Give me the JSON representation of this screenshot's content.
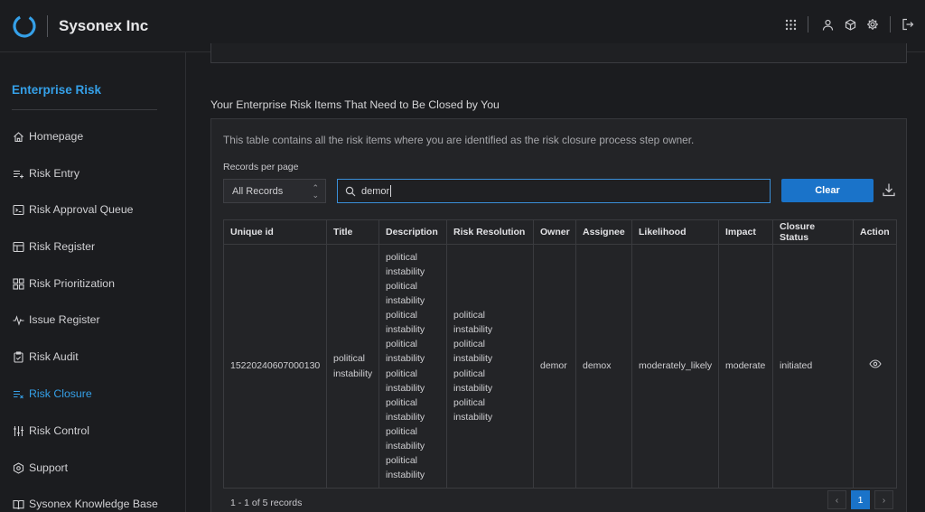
{
  "header": {
    "brand": "Sysonex Inc",
    "icons": [
      "apps-grid-icon",
      "user-icon",
      "cube-icon",
      "gear-icon",
      "logout-icon"
    ]
  },
  "sidebar": {
    "title": "Enterprise Risk",
    "items": [
      {
        "label": "Homepage",
        "icon": "home-icon"
      },
      {
        "label": "Risk Entry",
        "icon": "list-add-icon"
      },
      {
        "label": "Risk Approval Queue",
        "icon": "terminal-icon"
      },
      {
        "label": "Risk Register",
        "icon": "table-icon"
      },
      {
        "label": "Risk Prioritization",
        "icon": "grid-icon"
      },
      {
        "label": "Issue Register",
        "icon": "pulse-icon"
      },
      {
        "label": "Risk Audit",
        "icon": "clipboard-icon"
      },
      {
        "label": "Risk Closure",
        "icon": "list-close-icon",
        "active": true
      },
      {
        "label": "Risk Control",
        "icon": "sliders-icon"
      },
      {
        "label": "Support",
        "icon": "hexagon-icon"
      },
      {
        "label": "Sysonex Knowledge Base",
        "icon": "book-icon"
      }
    ]
  },
  "main": {
    "section_title": "Your Enterprise Risk Items That Need to Be Closed by You",
    "description": "This table contains all the risk items where you are identified as the risk closure process step owner.",
    "records_label": "Records per page",
    "records_value": "All Records",
    "search_value": "demor",
    "clear_label": "Clear",
    "columns": [
      "Unique id",
      "Title",
      "Description",
      "Risk Resolution",
      "Owner",
      "Assignee",
      "Likelihood",
      "Impact",
      "Closure Status",
      "Action"
    ],
    "rows": [
      {
        "unique_id": "15220240607000130",
        "title": "political instability",
        "description": "political instability political instability political instability political instability political instability political instability political instability political instability",
        "resolution": "political instability political instability political instability political instability",
        "owner": "demor",
        "assignee": "demox",
        "likelihood": "moderately_likely",
        "impact": "moderate",
        "closure_status": "initiated"
      }
    ],
    "records_summary": "1 - 1 of 5 records",
    "pagination": {
      "prev": "‹",
      "current": "1",
      "next": "›"
    }
  },
  "colors": {
    "accent": "#35a0e8",
    "button": "#1a73c9",
    "background": "#1b1c1f",
    "card": "#232427"
  }
}
